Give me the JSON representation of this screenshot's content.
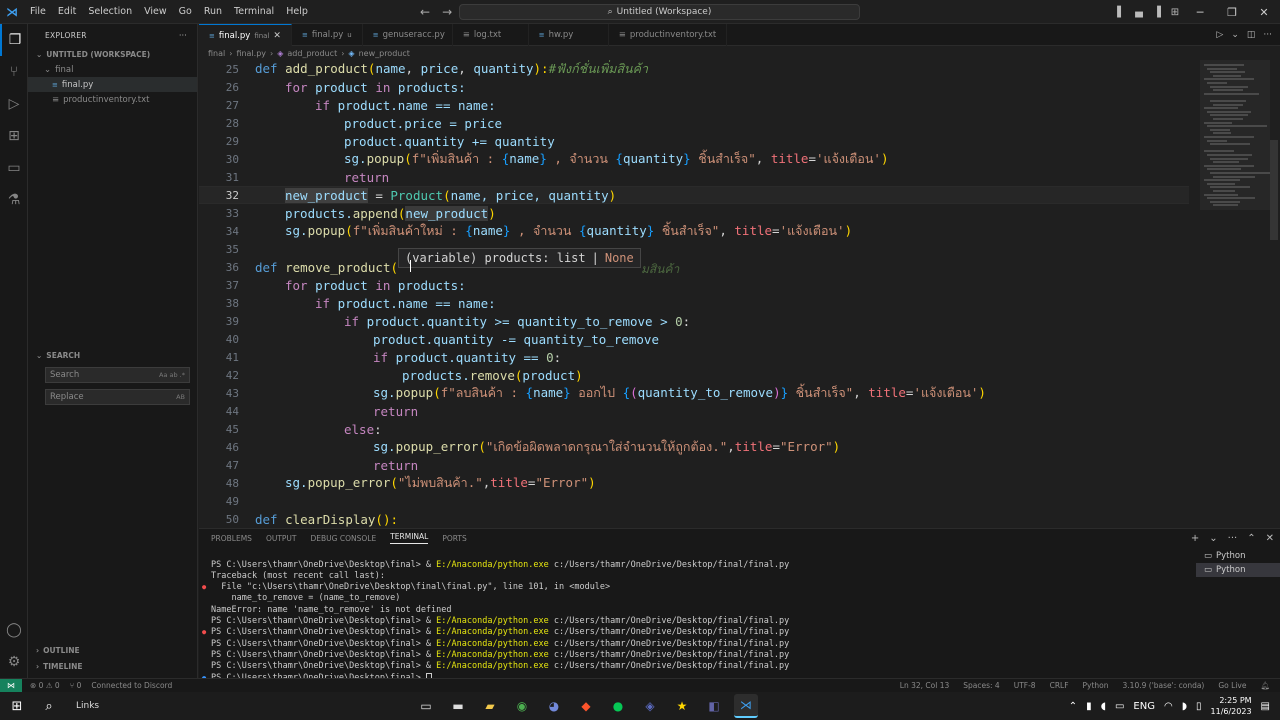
{
  "titlebar": {
    "menu": [
      "File",
      "Edit",
      "Selection",
      "View",
      "Go",
      "Run",
      "Terminal",
      "Help"
    ],
    "command_center": "Untitled (Workspace)"
  },
  "sidebar": {
    "explorer_title": "EXPLORER",
    "workspace_label": "UNTITLED (WORKSPACE)",
    "folder": "final",
    "files": [
      "final.py",
      "productinventory.txt"
    ],
    "search_title": "SEARCH",
    "search_placeholder": "Search",
    "replace_placeholder": "Replace",
    "search_opts": "Aa ab .*",
    "replace_opts": "AB",
    "outline": "OUTLINE",
    "timeline": "TIMELINE"
  },
  "tabs": [
    {
      "label": "final.py",
      "desc": "final",
      "active": true
    },
    {
      "label": "final.py",
      "desc": "u",
      "active": false
    },
    {
      "label": "genuseracc.py",
      "desc": "",
      "active": false
    },
    {
      "label": "log.txt",
      "desc": "",
      "active": false
    },
    {
      "label": "hw.py",
      "desc": "",
      "active": false
    },
    {
      "label": "productinventory.txt",
      "desc": "",
      "active": false
    }
  ],
  "breadcrumb": [
    "final",
    "final.py",
    "add_product",
    "new_product"
  ],
  "editor": {
    "line_numbers": [
      "25",
      "26",
      "27",
      "28",
      "29",
      "30",
      "31",
      "32",
      "33",
      "34",
      "35",
      "36",
      "37",
      "38",
      "39",
      "40",
      "41",
      "42",
      "43",
      "44",
      "45",
      "46",
      "47",
      "48",
      "49",
      "50"
    ],
    "current_line": "32",
    "hover_text": "(variable) products: list",
    "hover_sep": "|",
    "hover_none": "None",
    "hover_ghost": "มสินค้า"
  },
  "code": {
    "l25": {
      "kw": "def",
      "fn": "add_product",
      "open": "(",
      "p1": "name",
      "c1": ", ",
      "p2": "price",
      "c2": ", ",
      "p3": "quantity",
      "close": "):",
      "cmt": "#ฟังก์ชั่นเพิ่มสินค้า"
    },
    "l26": {
      "kw": "for",
      "a": " product ",
      "in": "in",
      "b": " products:"
    },
    "l27": {
      "kw": "if",
      "a": " product.name == name:"
    },
    "l28": {
      "a": "product.price = price"
    },
    "l29": {
      "a": "product.quantity += quantity"
    },
    "l30": {
      "a": "sg.",
      "fn": "popup",
      "o": "(",
      "s1": "f\"เพิ่มสินค้า : ",
      "b1": "{",
      "v1": "name",
      "b2": "}",
      "s2": " , จำนวน ",
      "b3": "{",
      "v2": "quantity",
      "b4": "}",
      "s3": " ชิ้นสำเร็จ\"",
      "c": ", ",
      "p": "title",
      "eq": "=",
      "s4": "'แจ้งเตือน'",
      "cl": ")"
    },
    "l31": {
      "kw": "return"
    },
    "l32": {
      "a": "new_product",
      "b": " = ",
      "fn": "Product",
      "o": "(",
      "args": "name, price, quantity",
      "cl": ")"
    },
    "l33": {
      "a": "products.",
      "fn": "append",
      "o": "(",
      "arg": "new_product",
      "cl": ")"
    },
    "l34": {
      "a": "sg.",
      "fn": "popup",
      "o": "(",
      "s1": "f\"เพิ่มสินค้าใหม่ : ",
      "b1": "{",
      "v1": "name",
      "b2": "}",
      "s2": " , จำนวน ",
      "b3": "{",
      "v2": "quantity",
      "b4": "}",
      "s3": " ชิ้นสำเร็จ\"",
      "c": ", ",
      "p": "title",
      "eq": "=",
      "s4": "'แจ้งเตือน'",
      "cl": ")"
    },
    "l36": {
      "kw": "def",
      "fn": "remove_product",
      "o": "("
    },
    "l37": {
      "kw": "for",
      "a": " product ",
      "in": "in",
      "b": " products:"
    },
    "l38": {
      "kw": "if",
      "a": " product.name == name:"
    },
    "l39": {
      "kw": "if",
      "a": " product.quantity >= quantity_to_remove > ",
      "n": "0",
      "b": ":"
    },
    "l40": {
      "a": "product.quantity -= quantity_to_remove"
    },
    "l41": {
      "kw": "if",
      "a": " product.quantity == ",
      "n": "0",
      "b": ":"
    },
    "l42": {
      "a": "products.",
      "fn": "remove",
      "o": "(",
      "arg": "product",
      "cl": ")"
    },
    "l43": {
      "a": "sg.",
      "fn": "popup",
      "o": "(",
      "s1": "f\"ลบสินค้า : ",
      "b1": "{",
      "v1": "name",
      "b2": "}",
      "s2": " ออกไป ",
      "b3": "{",
      "p1": "(",
      "v2": "quantity_to_remove",
      "p2": ")",
      "b4": "}",
      "s3": " ชิ้นสำเร็จ\"",
      "c": ", ",
      "p": "title",
      "eq": "=",
      "s4": "'แจ้งเตือน'",
      "cl": ")"
    },
    "l44": {
      "kw": "return"
    },
    "l45": {
      "kw": "else",
      "a": ":"
    },
    "l46": {
      "a": "sg.",
      "fn": "popup_error",
      "o": "(",
      "s1": "\"เกิดข้อผิดพลาดกรุณาใส่จำนวนให้ถูกต้อง.\"",
      "c": ",",
      "p": "title",
      "eq": "=",
      "s2": "\"Error\"",
      "cl": ")"
    },
    "l47": {
      "kw": "return"
    },
    "l48": {
      "a": "sg.",
      "fn": "popup_error",
      "o": "(",
      "s1": "\"ไม่พบสินค้า.\"",
      "c": ",",
      "p": "title",
      "eq": "=",
      "s2": "\"Error\"",
      "cl": ")"
    },
    "l50": {
      "kw": "def",
      "fn": "clearDisplay",
      "a": "():"
    }
  },
  "panel": {
    "tabs": [
      "PROBLEMS",
      "OUTPUT",
      "DEBUG CONSOLE",
      "TERMINAL",
      "PORTS"
    ],
    "active_tab": "TERMINAL",
    "terminals": [
      "Python",
      "Python"
    ],
    "lines": [
      {
        "ps": "PS C:\\Users\\thamr\\OneDrive\\Desktop\\final> & ",
        "cmd": "E:/Anaconda/python.exe",
        "rest": " c:/Users/thamr/OneDrive/Desktop/final/final.py",
        "dot": ""
      },
      {
        "ps": "Traceback (most recent call last):",
        "cmd": "",
        "rest": "",
        "dot": ""
      },
      {
        "ps": "  File \"c:\\Users\\thamr\\OneDrive\\Desktop\\final\\final.py\", line 101, in <module>",
        "cmd": "",
        "rest": "",
        "dot": "err"
      },
      {
        "ps": "    name_to_remove = (name_to_remove)",
        "cmd": "",
        "rest": "",
        "dot": ""
      },
      {
        "ps": "NameError: name 'name_to_remove' is not defined",
        "cmd": "",
        "rest": "",
        "dot": ""
      },
      {
        "ps": "PS C:\\Users\\thamr\\OneDrive\\Desktop\\final> & ",
        "cmd": "E:/Anaconda/python.exe",
        "rest": " c:/Users/thamr/OneDrive/Desktop/final/final.py",
        "dot": ""
      },
      {
        "ps": "PS C:\\Users\\thamr\\OneDrive\\Desktop\\final> & ",
        "cmd": "E:/Anaconda/python.exe",
        "rest": " c:/Users/thamr/OneDrive/Desktop/final/final.py",
        "dot": "err"
      },
      {
        "ps": "PS C:\\Users\\thamr\\OneDrive\\Desktop\\final> & ",
        "cmd": "E:/Anaconda/python.exe",
        "rest": " c:/Users/thamr/OneDrive/Desktop/final/final.py",
        "dot": ""
      },
      {
        "ps": "PS C:\\Users\\thamr\\OneDrive\\Desktop\\final> & ",
        "cmd": "E:/Anaconda/python.exe",
        "rest": " c:/Users/thamr/OneDrive/Desktop/final/final.py",
        "dot": ""
      },
      {
        "ps": "PS C:\\Users\\thamr\\OneDrive\\Desktop\\final> & ",
        "cmd": "E:/Anaconda/python.exe",
        "rest": " c:/Users/thamr/OneDrive/Desktop/final/final.py",
        "dot": ""
      },
      {
        "ps": "PS C:\\Users\\thamr\\OneDrive\\Desktop\\final> ",
        "cmd": "",
        "rest": "",
        "dot": "ok"
      }
    ]
  },
  "statusbar": {
    "problems": "⊗ 0 ⚠ 0",
    "ports": "⑂ 0",
    "discord": "Connected to Discord",
    "cursor": "Ln 32, Col 13",
    "spaces": "Spaces: 4",
    "encoding": "UTF-8",
    "eol": "CRLF",
    "language": "Python",
    "interpreter": "3.10.9 ('base': conda)",
    "golive": "Go Live"
  },
  "taskbar": {
    "links": "Links",
    "lang": "ENG",
    "time": "2:25 PM",
    "date": "11/6/2023"
  }
}
